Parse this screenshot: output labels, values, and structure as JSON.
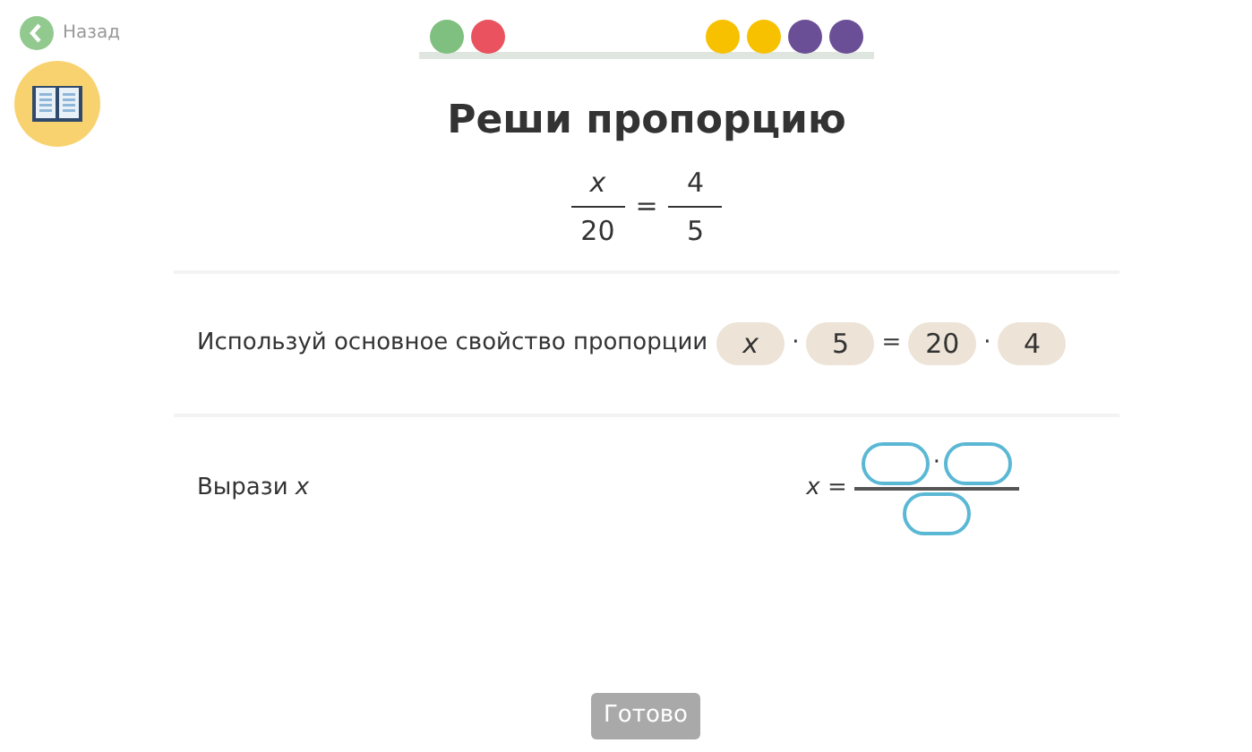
{
  "back_link": {
    "label": "Назад"
  },
  "progress": {
    "groups": [
      {
        "dots": [
          {
            "color": "#7fbf7f"
          },
          {
            "color": "#e9525e"
          }
        ]
      },
      {
        "dots": [
          {
            "color": "#f7c100"
          },
          {
            "color": "#f7c100"
          },
          {
            "color": "#6b4f96"
          },
          {
            "color": "#6b4f96"
          }
        ]
      }
    ]
  },
  "title": "Реши пропорцию",
  "proportion": {
    "left": {
      "numerator": "x",
      "denominator": "20"
    },
    "equals": "=",
    "right": {
      "numerator": "4",
      "denominator": "5"
    }
  },
  "steps": [
    {
      "kind": "chips",
      "prompt": "Используй основное свойство пропорции",
      "tokens": [
        {
          "kind": "variable",
          "text": "x"
        },
        {
          "kind": "operator",
          "text": "·"
        },
        {
          "kind": "number",
          "text": "5"
        },
        {
          "kind": "operator",
          "text": "="
        },
        {
          "kind": "number",
          "text": "20"
        },
        {
          "kind": "operator",
          "text": "·"
        },
        {
          "kind": "number",
          "text": "4"
        }
      ]
    },
    {
      "kind": "fraction_input",
      "prompt": "Вырази *x*",
      "lhs": "*x* =",
      "operator": "·"
    }
  ],
  "done_button": {
    "label": "Готово",
    "disabled": true
  }
}
